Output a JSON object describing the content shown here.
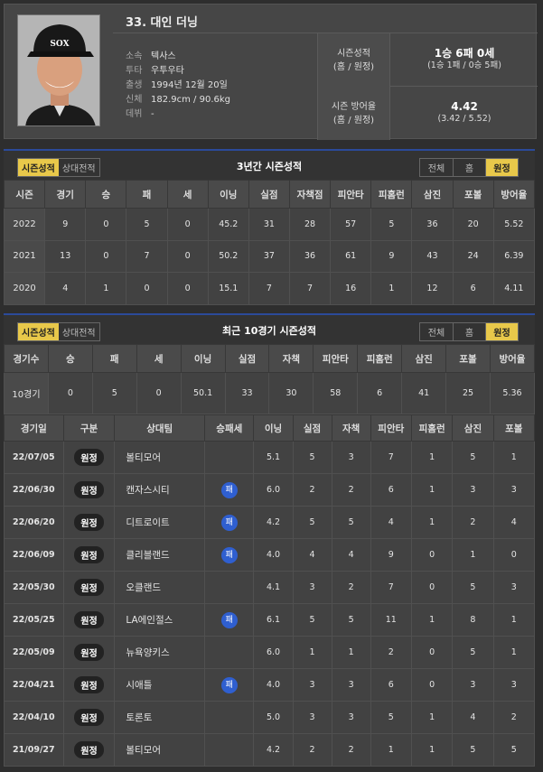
{
  "player": {
    "name": "33. 대인 더닝",
    "info": [
      {
        "label": "소속",
        "value": "텍사스"
      },
      {
        "label": "투타",
        "value": "우투우타"
      },
      {
        "label": "출생",
        "value": "1994년 12월 20일"
      },
      {
        "label": "신체",
        "value": "182.9cm / 90.6kg"
      },
      {
        "label": "데뷔",
        "value": "-"
      }
    ],
    "season_record": {
      "label_line1": "시즌성적",
      "label_line2": "(홈 / 원정)",
      "value": "1승 6패 0세",
      "sub": "(1승 1패 / 0승 5패)"
    },
    "season_era": {
      "label_line1": "시즌 방어율",
      "label_line2": "(홈 / 원정)",
      "value": "4.42",
      "sub": "(3.42 / 5.52)"
    }
  },
  "tabs": {
    "season": "시즌성적",
    "versus": "상대전적"
  },
  "filters": {
    "all": "전체",
    "home": "홈",
    "away": "원정"
  },
  "panel1": {
    "title": "3년간 시즌성적",
    "headers": [
      "시즌",
      "경기",
      "승",
      "패",
      "세",
      "이닝",
      "실점",
      "자책점",
      "피안타",
      "피홈런",
      "삼진",
      "포볼",
      "방어율"
    ],
    "rows": [
      [
        "2022",
        "9",
        "0",
        "5",
        "0",
        "45.2",
        "31",
        "28",
        "57",
        "5",
        "36",
        "20",
        "5.52"
      ],
      [
        "2021",
        "13",
        "0",
        "7",
        "0",
        "50.2",
        "37",
        "36",
        "61",
        "9",
        "43",
        "24",
        "6.39"
      ],
      [
        "2020",
        "4",
        "1",
        "0",
        "0",
        "15.1",
        "7",
        "7",
        "16",
        "1",
        "12",
        "6",
        "4.11"
      ]
    ]
  },
  "panel2": {
    "title": "최근 10경기 시즌성적",
    "summary_headers": [
      "경기수",
      "승",
      "패",
      "세",
      "이닝",
      "실점",
      "자책",
      "피안타",
      "피홈런",
      "삼진",
      "포볼",
      "방어율"
    ],
    "summary_row": [
      "10경기",
      "0",
      "5",
      "0",
      "50.1",
      "33",
      "30",
      "58",
      "6",
      "41",
      "25",
      "5.36"
    ],
    "game_headers": [
      "경기일",
      "구분",
      "상대팀",
      "승패세",
      "이닝",
      "실점",
      "자책",
      "피안타",
      "피홈런",
      "삼진",
      "포볼"
    ],
    "games": [
      {
        "date": "22/07/05",
        "type": "원정",
        "team": "볼티모어",
        "dec": "",
        "ip": "5.1",
        "r": "5",
        "er": "3",
        "h": "7",
        "hr": "1",
        "so": "5",
        "bb": "1"
      },
      {
        "date": "22/06/30",
        "type": "원정",
        "team": "캔자스시티",
        "dec": "패",
        "ip": "6.0",
        "r": "2",
        "er": "2",
        "h": "6",
        "hr": "1",
        "so": "3",
        "bb": "3"
      },
      {
        "date": "22/06/20",
        "type": "원정",
        "team": "디트로이트",
        "dec": "패",
        "ip": "4.2",
        "r": "5",
        "er": "5",
        "h": "4",
        "hr": "1",
        "so": "2",
        "bb": "4"
      },
      {
        "date": "22/06/09",
        "type": "원정",
        "team": "클리블랜드",
        "dec": "패",
        "ip": "4.0",
        "r": "4",
        "er": "4",
        "h": "9",
        "hr": "0",
        "so": "1",
        "bb": "0"
      },
      {
        "date": "22/05/30",
        "type": "원정",
        "team": "오클랜드",
        "dec": "",
        "ip": "4.1",
        "r": "3",
        "er": "2",
        "h": "7",
        "hr": "0",
        "so": "5",
        "bb": "3"
      },
      {
        "date": "22/05/25",
        "type": "원정",
        "team": "LA에인절스",
        "dec": "패",
        "ip": "6.1",
        "r": "5",
        "er": "5",
        "h": "11",
        "hr": "1",
        "so": "8",
        "bb": "1"
      },
      {
        "date": "22/05/09",
        "type": "원정",
        "team": "뉴욕양키스",
        "dec": "",
        "ip": "6.0",
        "r": "1",
        "er": "1",
        "h": "2",
        "hr": "0",
        "so": "5",
        "bb": "1"
      },
      {
        "date": "22/04/21",
        "type": "원정",
        "team": "시애틀",
        "dec": "패",
        "ip": "4.0",
        "r": "3",
        "er": "3",
        "h": "6",
        "hr": "0",
        "so": "3",
        "bb": "3"
      },
      {
        "date": "22/04/10",
        "type": "원정",
        "team": "토론토",
        "dec": "",
        "ip": "5.0",
        "r": "3",
        "er": "3",
        "h": "5",
        "hr": "1",
        "so": "4",
        "bb": "2"
      },
      {
        "date": "21/09/27",
        "type": "원정",
        "team": "볼티모어",
        "dec": "",
        "ip": "4.2",
        "r": "2",
        "er": "2",
        "h": "1",
        "hr": "1",
        "so": "5",
        "bb": "5"
      }
    ]
  }
}
